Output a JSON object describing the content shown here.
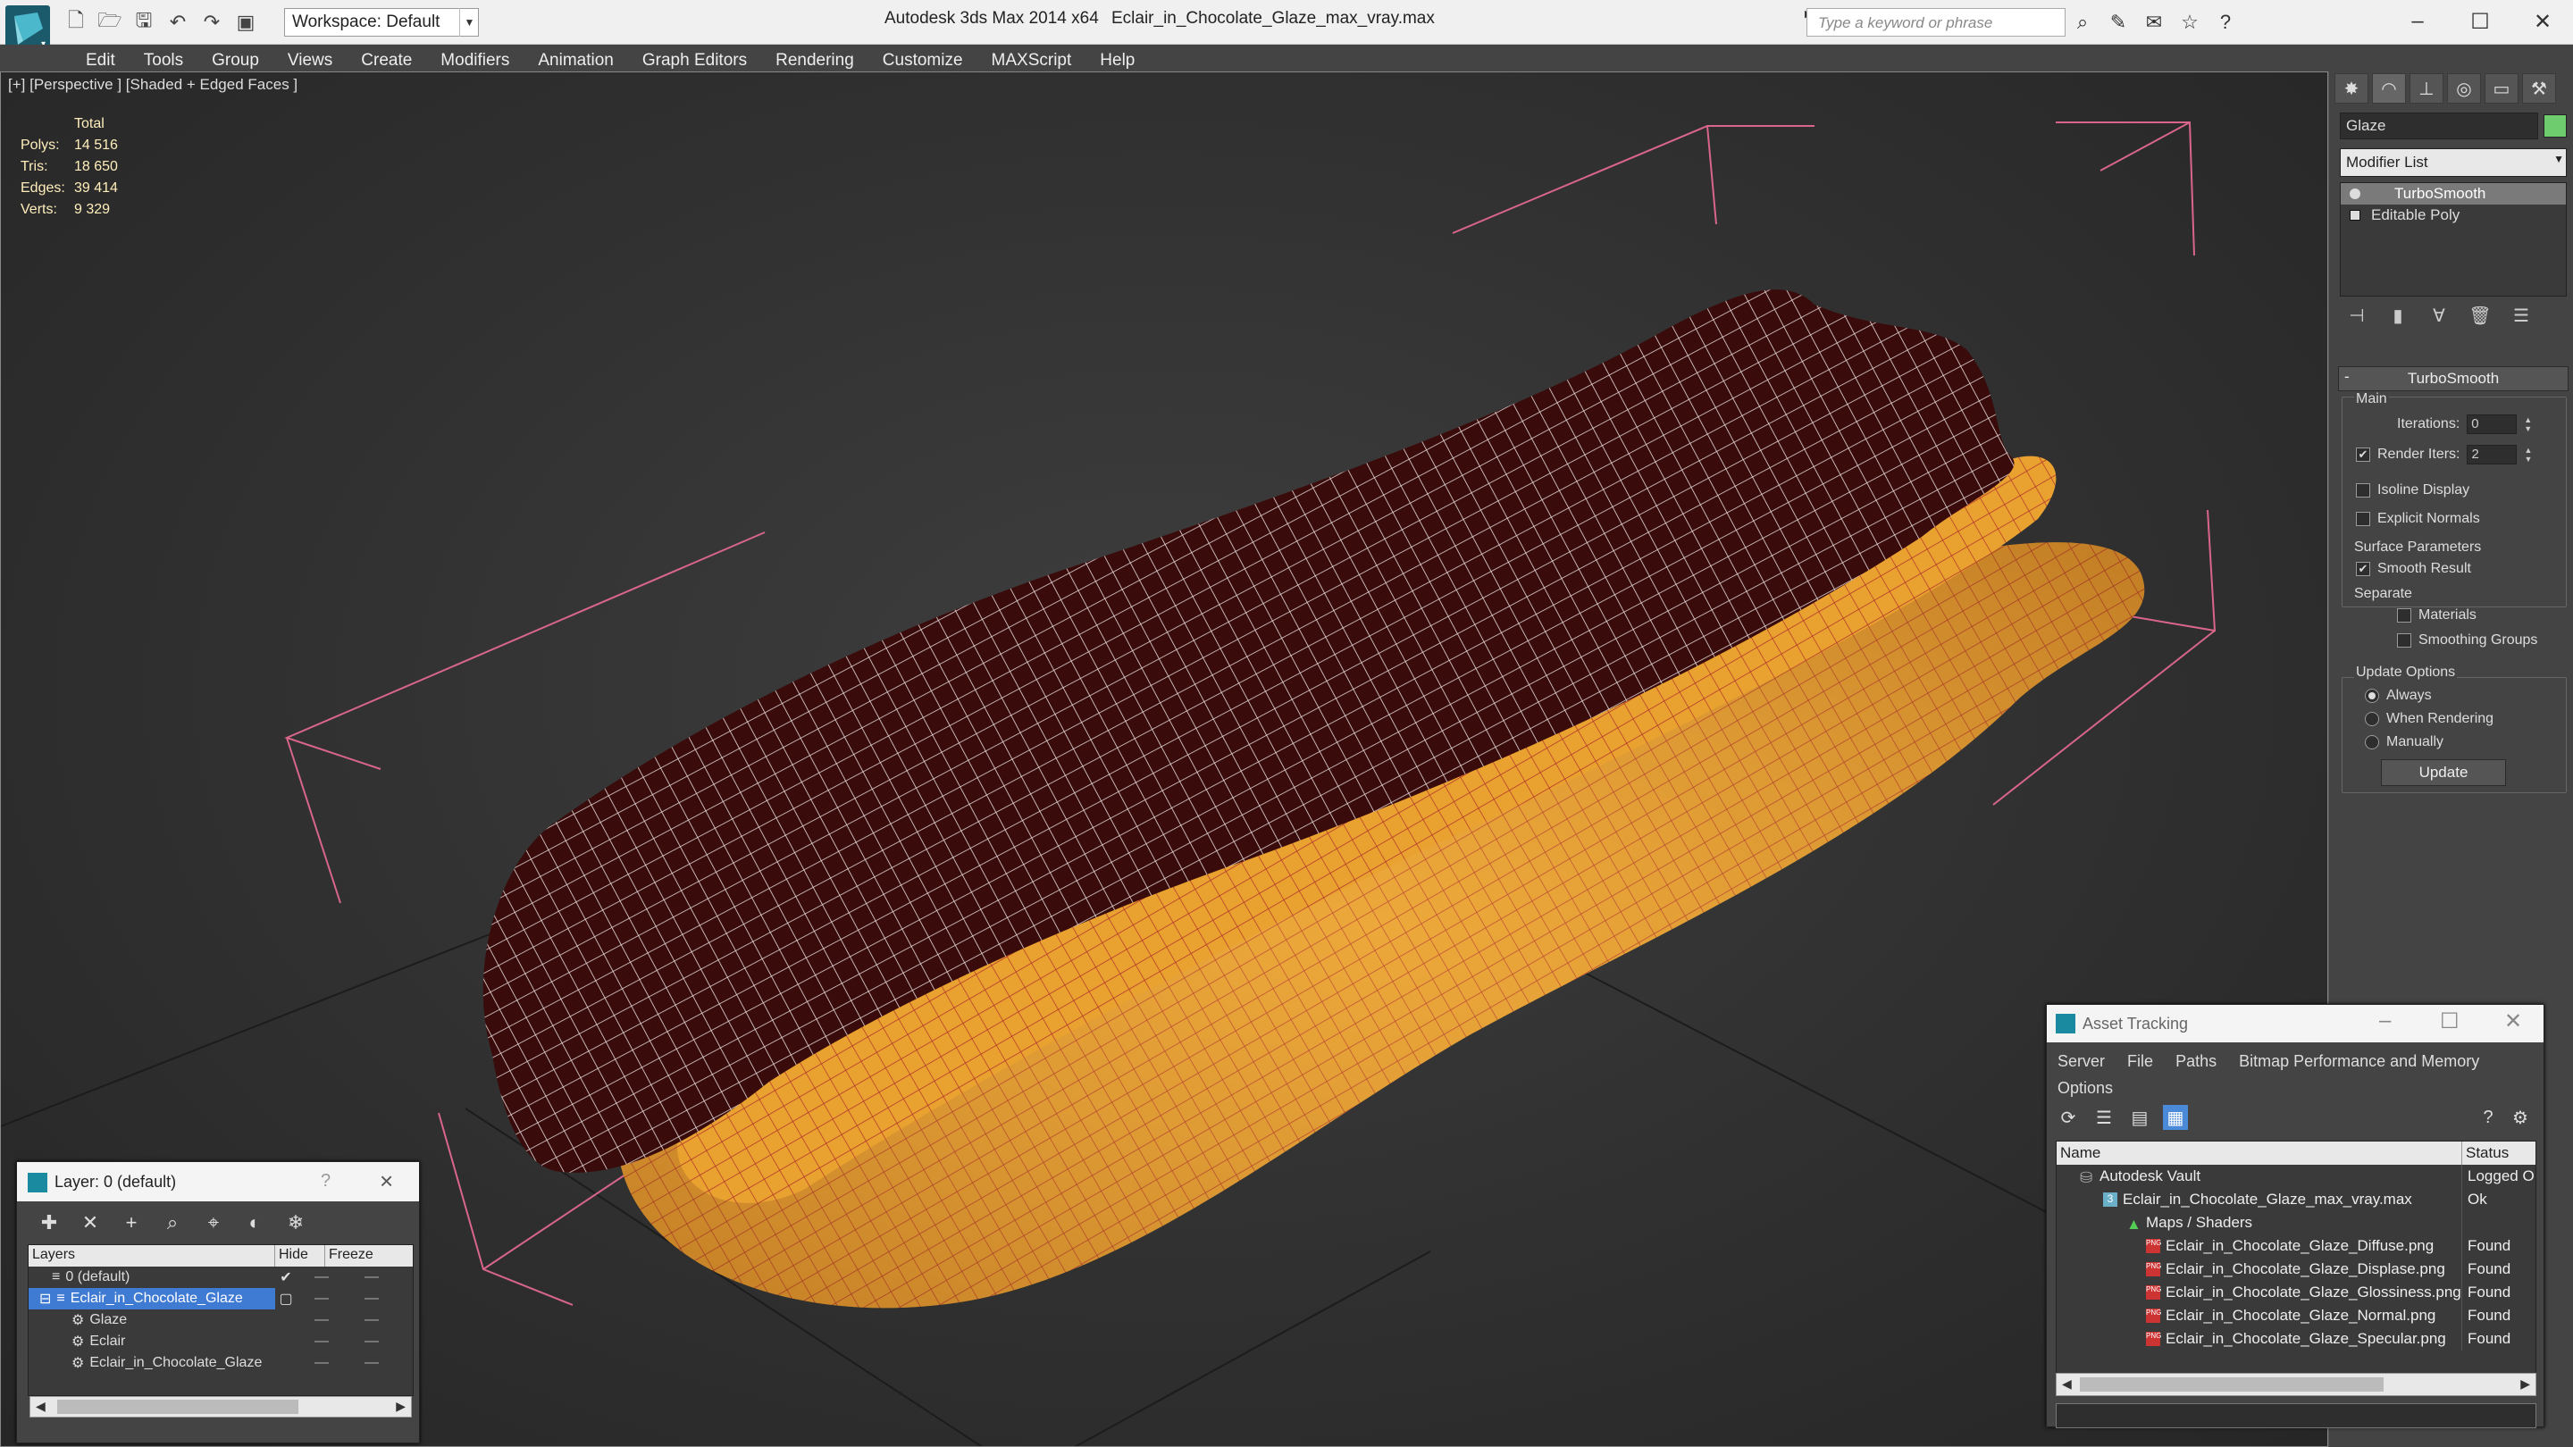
{
  "titlebar": {
    "app_title": "Autodesk 3ds Max  2014 x64",
    "file_title": "Eclair_in_Chocolate_Glaze_max_vray.max",
    "workspace": "Workspace: Default",
    "search_placeholder": "Type a keyword or phrase"
  },
  "menus": [
    "Edit",
    "Tools",
    "Group",
    "Views",
    "Create",
    "Modifiers",
    "Animation",
    "Graph Editors",
    "Rendering",
    "Customize",
    "MAXScript",
    "Help"
  ],
  "viewport": {
    "label": "[+] [Perspective ] [Shaded + Edged Faces ]",
    "stats": {
      "header": "Total",
      "rows": [
        {
          "key": "Polys:",
          "value": "14 516"
        },
        {
          "key": "Tris:",
          "value": "18 650"
        },
        {
          "key": "Edges:",
          "value": "39 414"
        },
        {
          "key": "Verts:",
          "value": "9 329"
        }
      ]
    }
  },
  "command_panel": {
    "object_name": "Glaze",
    "object_color": "#6ecb6e",
    "modifier_list": "Modifier List",
    "stack": [
      "TurboSmooth",
      "Editable Poly"
    ],
    "rollout_title": "TurboSmooth",
    "main_label": "Main",
    "iterations_label": "Iterations:",
    "iterations_value": "0",
    "render_iters_label": "Render Iters:",
    "render_iters_value": "2",
    "render_iters_checked": true,
    "isoline_label": "Isoline Display",
    "explicit_label": "Explicit Normals",
    "surface_label": "Surface Parameters",
    "smooth_label": "Smooth Result",
    "smooth_checked": true,
    "separate_label": "Separate",
    "materials_label": "Materials",
    "smoothing_groups_label": "Smoothing Groups",
    "update_options_label": "Update Options",
    "always_label": "Always",
    "when_rendering_label": "When Rendering",
    "manually_label": "Manually",
    "update_button": "Update"
  },
  "layer_window": {
    "title": "Layer: 0 (default)",
    "help": "?",
    "columns": [
      "Layers",
      "Hide",
      "Freeze"
    ],
    "rows": [
      {
        "name": "0 (default)",
        "indent": 0,
        "selected": false,
        "current": true
      },
      {
        "name": "Eclair_in_Chocolate_Glaze",
        "indent": 0,
        "selected": true,
        "current": false
      },
      {
        "name": "Glaze",
        "indent": 1,
        "selected": false,
        "current": false
      },
      {
        "name": "Eclair",
        "indent": 1,
        "selected": false,
        "current": false
      },
      {
        "name": "Eclair_in_Chocolate_Glaze",
        "indent": 1,
        "selected": false,
        "current": false
      }
    ],
    "dash": "—"
  },
  "asset_window": {
    "title": "Asset Tracking",
    "menus": [
      "Server",
      "File",
      "Paths",
      "Bitmap Performance and Memory"
    ],
    "menu_options": "Options",
    "columns": [
      "Name",
      "Status"
    ],
    "rows": [
      {
        "name": "Autodesk Vault",
        "status": "Logged O",
        "indent": 1,
        "icon": "vault"
      },
      {
        "name": "Eclair_in_Chocolate_Glaze_max_vray.max",
        "status": "Ok",
        "indent": 2,
        "icon": "max"
      },
      {
        "name": "Maps / Shaders",
        "status": "",
        "indent": 3,
        "icon": "folder"
      },
      {
        "name": "Eclair_in_Chocolate_Glaze_Diffuse.png",
        "status": "Found",
        "indent": 4,
        "icon": "png"
      },
      {
        "name": "Eclair_in_Chocolate_Glaze_Displase.png",
        "status": "Found",
        "indent": 4,
        "icon": "png"
      },
      {
        "name": "Eclair_in_Chocolate_Glaze_Glossiness.png",
        "status": "Found",
        "indent": 4,
        "icon": "png"
      },
      {
        "name": "Eclair_in_Chocolate_Glaze_Normal.png",
        "status": "Found",
        "indent": 4,
        "icon": "png"
      },
      {
        "name": "Eclair_in_Chocolate_Glaze_Specular.png",
        "status": "Found",
        "indent": 4,
        "icon": "png"
      }
    ]
  }
}
